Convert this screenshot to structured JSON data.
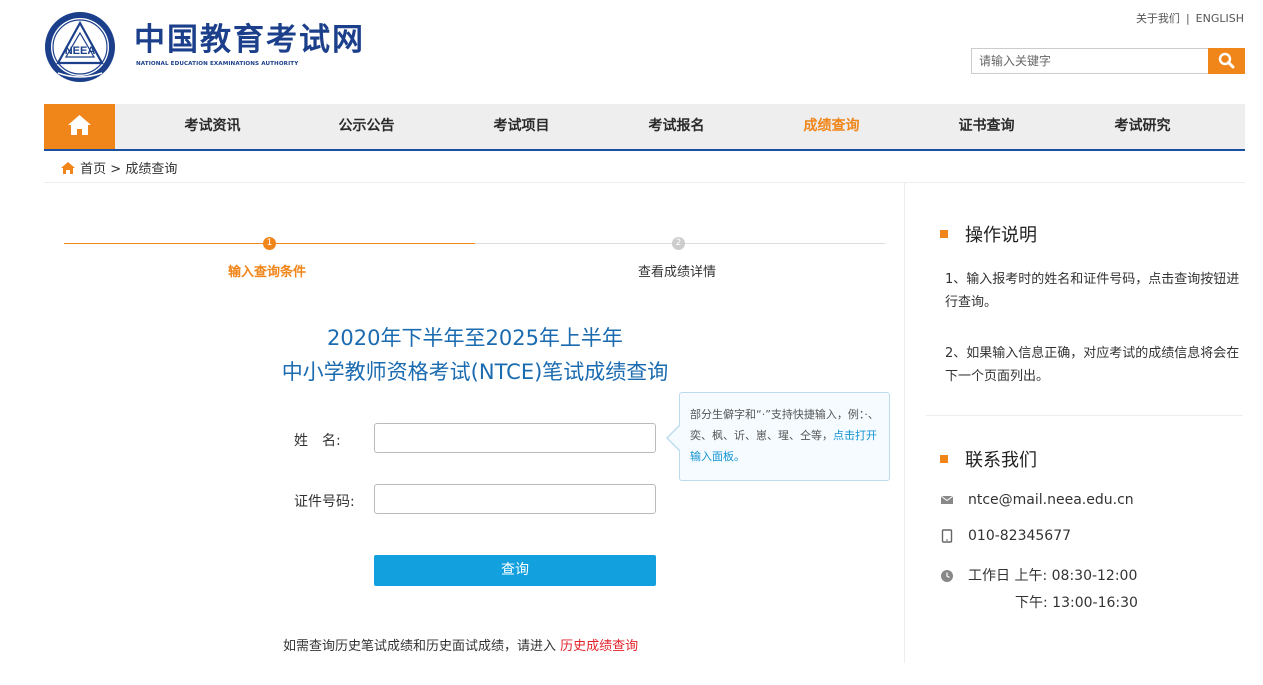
{
  "header": {
    "logo_text": "NEEA",
    "site_title": "中国教育考试网",
    "site_subtitle": "NATIONAL EDUCATION EXAMINATIONS AUTHORITY",
    "top_links": [
      "关于我们",
      "ENGLISH"
    ],
    "top_links_separator": "|",
    "search_placeholder": "请输入关键字",
    "search_icon": "search-icon"
  },
  "nav": {
    "home_icon": "home-icon",
    "items": [
      {
        "label": "考试资讯",
        "active": false
      },
      {
        "label": "公示公告",
        "active": false
      },
      {
        "label": "考试项目",
        "active": false
      },
      {
        "label": "考试报名",
        "active": false
      },
      {
        "label": "成绩查询",
        "active": true
      },
      {
        "label": "证书查询",
        "active": false
      },
      {
        "label": "考试研究",
        "active": false
      }
    ]
  },
  "breadcrumb": {
    "home": "首页",
    "separator": ">",
    "current": "成绩查询"
  },
  "steps": [
    {
      "number": "1",
      "label": "输入查询条件",
      "active": true
    },
    {
      "number": "2",
      "label": "查看成绩详情",
      "active": false
    }
  ],
  "main": {
    "title_line1": "2020年下半年至2025年上半年",
    "title_line2": "中小学教师资格考试(NTCE)笔试成绩查询"
  },
  "form": {
    "name_label": "姓　名:",
    "id_label": "证件号码:",
    "name_value": "",
    "id_value": "",
    "submit_label": "查询",
    "tooltip_text": "部分生僻字和“·”支持快捷输入，例：·、奕、枫、䜣、崽、瑆、仝等，",
    "tooltip_link": "点击打开输入面板。"
  },
  "history": {
    "text": "如需查询历史笔试成绩和历史面试成绩，请进入",
    "link": "历史成绩查询"
  },
  "sidebar": {
    "instructions_title": "操作说明",
    "instructions": [
      "1、输入报考时的姓名和证件号码，点击查询按钮进行查询。",
      "2、如果输入信息正确，对应考试的成绩信息将会在下一个页面列出。"
    ],
    "contact_title": "联系我们",
    "email": "ntce@mail.neea.edu.cn",
    "phone": "010-82345677",
    "hours_label": "工作日",
    "am_label": "上午:",
    "am_hours": "08:30-12:00",
    "pm_label": "下午:",
    "pm_hours": "13:00-16:30"
  },
  "colors": {
    "brand_blue": "#1b3f8a",
    "accent_orange": "#f08519",
    "button_blue": "#13a0de",
    "title_blue": "#1b6bb0",
    "link_red": "#e3232b"
  }
}
